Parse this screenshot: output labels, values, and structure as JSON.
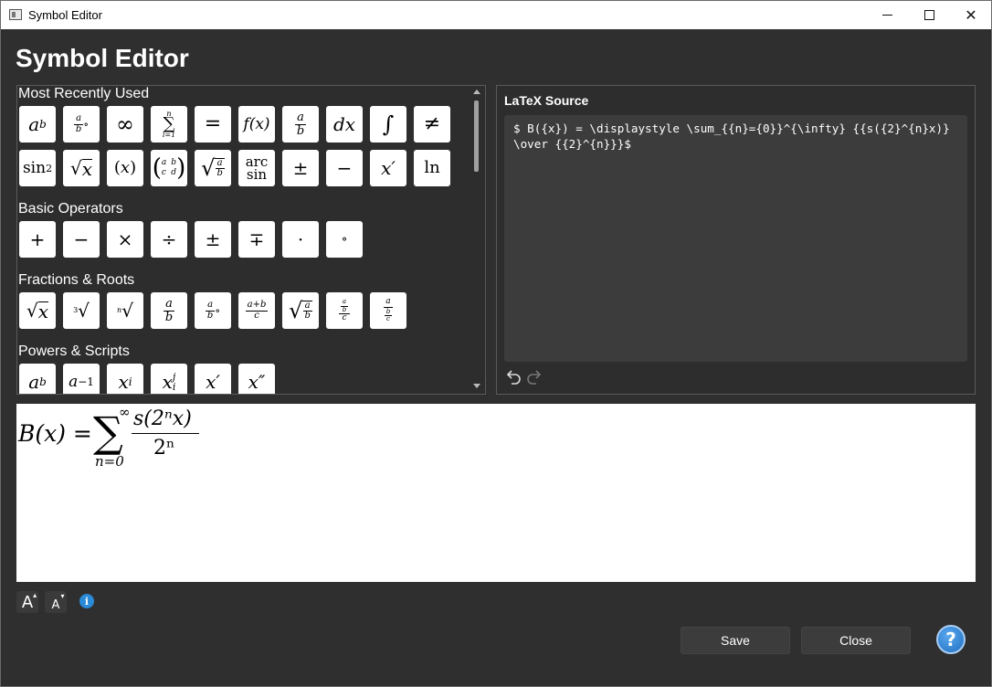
{
  "window": {
    "title": "Symbol Editor",
    "minimize_label": "minimize",
    "maximize_label": "maximize",
    "close_glyph": "✕"
  },
  "page_title": "Symbol Editor",
  "palette": {
    "sections": [
      {
        "title": "Most Recently Used",
        "symbols": [
          "a^b",
          "a/b∘",
          "∞",
          "Σ",
          "=",
          "f(x)",
          "a/b",
          "dx",
          "∫",
          "≠",
          "sin²",
          "√x",
          "(x)",
          "matrix",
          "√(a/b)",
          "arcsin",
          "±",
          "−",
          "x′",
          "ln"
        ]
      },
      {
        "title": "Basic Operators",
        "symbols": [
          "+",
          "−",
          "×",
          "÷",
          "±",
          "∓",
          "·",
          "∘"
        ]
      },
      {
        "title": "Fractions & Roots",
        "symbols": [
          "√x",
          "∛x",
          "ⁿ√x",
          "a/b",
          "a/b∘",
          "(a+b)/c",
          "√(a/b)",
          "(a/b)/c",
          "a/(b/c)"
        ]
      },
      {
        "title": "Powers & Scripts",
        "symbols": [
          "a^b",
          "a^-1",
          "x_i",
          "x_i^j",
          "x′",
          "x″"
        ]
      }
    ]
  },
  "latex": {
    "label": "LaTeX Source",
    "source": "$ B({x}) = \\displaystyle \\sum_{{n}={0}}^{\\infty} {{s({2}^{n}x)} \\over {{2}^{n}}}$",
    "undo_icon": "undo-icon",
    "redo_icon": "redo-icon"
  },
  "preview": {
    "lhs": "B(x) =",
    "sum_upper": "∞",
    "sum_symbol": "∑",
    "sum_lower": "n=0",
    "numerator": "s(2ⁿx)",
    "denominator": "2ⁿ"
  },
  "toolbar": {
    "increase_font_icon": "font-increase-icon",
    "decrease_font_icon": "font-decrease-icon",
    "info_glyph": "i"
  },
  "buttons": {
    "save": "Save",
    "close": "Close",
    "help": "?"
  }
}
